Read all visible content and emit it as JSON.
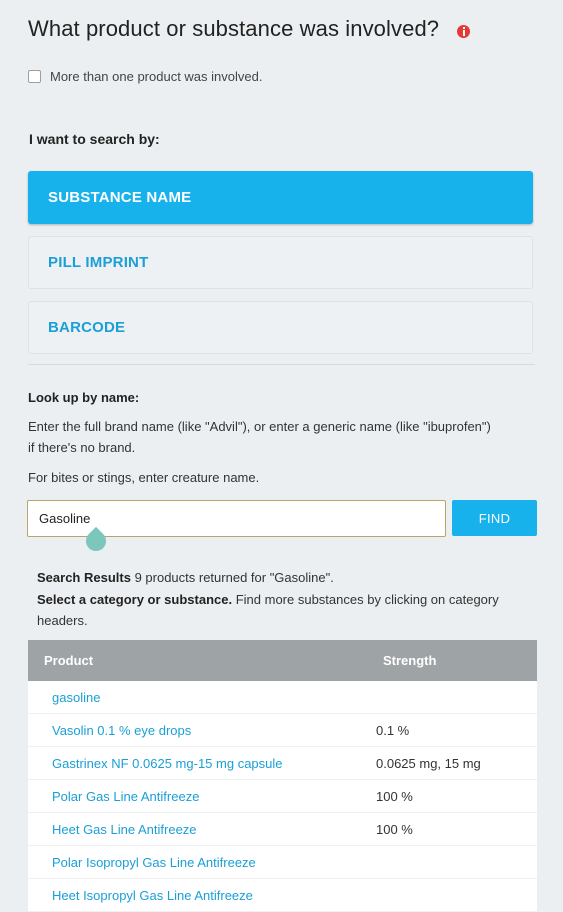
{
  "title": "What product or substance was involved?",
  "multi_product_label": "More than one product was involved.",
  "search_by_label": "I want to search by:",
  "search_options": [
    {
      "label": "SUBSTANCE NAME",
      "active": true
    },
    {
      "label": "PILL IMPRINT",
      "active": false
    },
    {
      "label": "BARCODE",
      "active": false
    }
  ],
  "lookup": {
    "label": "Look up by name:",
    "instructions": "Enter the full brand name (like \"Advil\"), or enter a generic name (like \"ibuprofen\") if there's no brand.",
    "bites_note": "For bites or stings, enter creature name.",
    "input_value": "Gasoline",
    "find_label": "FIND"
  },
  "results": {
    "heading": "Search Results",
    "summary": "9 products returned for \"Gasoline\".",
    "select_heading": "Select a category or substance.",
    "select_hint": "Find more substances by clicking on category headers."
  },
  "table": {
    "columns": [
      "Product",
      "Strength"
    ],
    "rows": [
      {
        "product": "gasoline",
        "strength": ""
      },
      {
        "product": "Vasolin 0.1 % eye drops",
        "strength": "0.1 %"
      },
      {
        "product": "Gastrinex NF 0.0625 mg-15 mg capsule",
        "strength": "0.0625 mg, 15 mg"
      },
      {
        "product": "Polar Gas Line Antifreeze",
        "strength": "100 %"
      },
      {
        "product": "Heet Gas Line Antifreeze",
        "strength": "100 %"
      },
      {
        "product": "Polar Isopropyl Gas Line Antifreeze",
        "strength": ""
      },
      {
        "product": "Heet Isopropyl Gas Line Antifreeze",
        "strength": ""
      }
    ]
  },
  "colors": {
    "accent": "#17b1ec",
    "link": "#1a9fd6",
    "info_icon": "#e53935",
    "table_header": "#9ea3a5"
  },
  "icons": {
    "info": "info-icon",
    "text_cursor_handle": "cursor-handle"
  }
}
